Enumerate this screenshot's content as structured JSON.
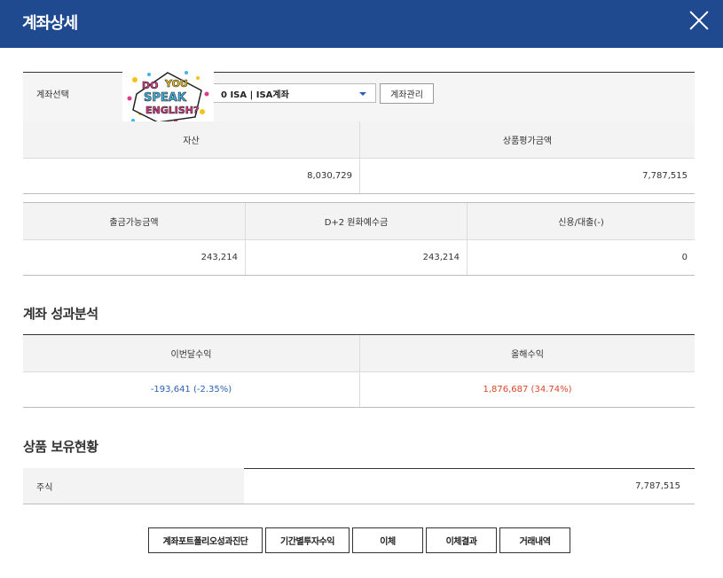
{
  "header": {
    "title": "계좌상세",
    "close_icon": "close-icon"
  },
  "account": {
    "label": "계좌선택",
    "selected": "0  ISA | ISA계좌",
    "manage_button": "계좌관리",
    "sticker_text": [
      "DO",
      "YOU",
      "SPEAK",
      "ENGLISH?"
    ]
  },
  "summary1": {
    "headers": [
      "자산",
      "상품평가금액"
    ],
    "values": [
      "8,030,729",
      "7,787,515"
    ]
  },
  "summary2": {
    "headers": [
      "출금가능금액",
      "D+2 원화예수금",
      "신용/대출(-)"
    ],
    "values": [
      "243,214",
      "243,214",
      "0"
    ]
  },
  "performance": {
    "title": "계좌 성과분석",
    "headers": [
      "이번달수익",
      "올해수익"
    ],
    "values": [
      "-193,641 (-2.35%)",
      "1,876,687 (34.74%)"
    ],
    "colors": {
      "negative": "#2b62b8",
      "positive": "#d9472b"
    }
  },
  "holdings": {
    "title": "상품 보유현황",
    "rows": [
      {
        "label": "주식",
        "value": "7,787,515"
      }
    ]
  },
  "buttons": [
    "계좌포트폴리오성과진단",
    "기간별투자수익",
    "이체",
    "이체결과",
    "거래내역"
  ],
  "colors": {
    "header_bg": "#1f4a8f",
    "header_cell_bg": "#f3f3f3"
  }
}
